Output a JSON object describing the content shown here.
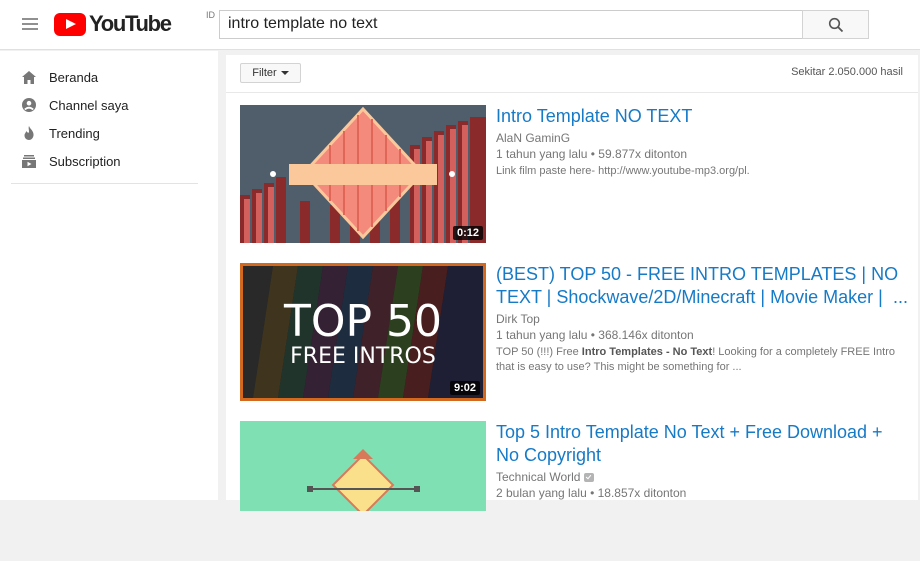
{
  "header": {
    "logo_text": "YouTube",
    "logo_country": "ID",
    "search_value": "intro template no text"
  },
  "sidebar": {
    "items": [
      {
        "label": "Beranda",
        "icon": "home-icon"
      },
      {
        "label": "Channel saya",
        "icon": "person-icon"
      },
      {
        "label": "Trending",
        "icon": "flame-icon"
      },
      {
        "label": "Subscription",
        "icon": "subscriptions-icon"
      }
    ]
  },
  "filter": {
    "label": "Filter",
    "result_count": "Sekitar 2.050.000 hasil"
  },
  "results": [
    {
      "title": "Intro Template NO TEXT",
      "channel": "AlaN GaminG",
      "meta": "1 tahun yang lalu  •  59.877x ditonton",
      "desc": "Link film paste here- http://www.youtube-mp3.org/pl.",
      "duration": "0:12"
    },
    {
      "title": "(BEST) TOP 50 - FREE INTRO TEMPLATES | NO TEXT | Shockwave/2D/Minecraft | Movie Maker | ...",
      "title_line1": "(BEST) TOP 50 - FREE INTRO TEMPLATES | NO",
      "title_line2": "TEXT | Shockwave/2D/Minecraft | Movie Maker |",
      "title_ellipsis": "...",
      "channel": "Dirk Top",
      "meta": "1 tahun yang lalu  •  368.146x ditonton",
      "desc_pre": "TOP 50 (!!!) Free ",
      "desc_bold": "Intro Templates - No Text",
      "desc_post": "! Looking for a completely FREE Intro that is easy to use? This might be something for ...",
      "duration": "9:02",
      "thumb_line1": "TOP 50",
      "thumb_line2": "FREE INTROS"
    },
    {
      "title": "Top 5 Intro Template No Text + Free Download + No Copyright",
      "title_line1": "Top 5 Intro Template No Text + Free Download +",
      "title_line2": "No Copyright",
      "channel": "Technical World",
      "meta": "2 bulan yang lalu  •  18.857x ditonton"
    }
  ],
  "colors": {
    "brand_red": "#ff0000",
    "link_blue": "#167ac6",
    "meta_gray": "#767676"
  }
}
